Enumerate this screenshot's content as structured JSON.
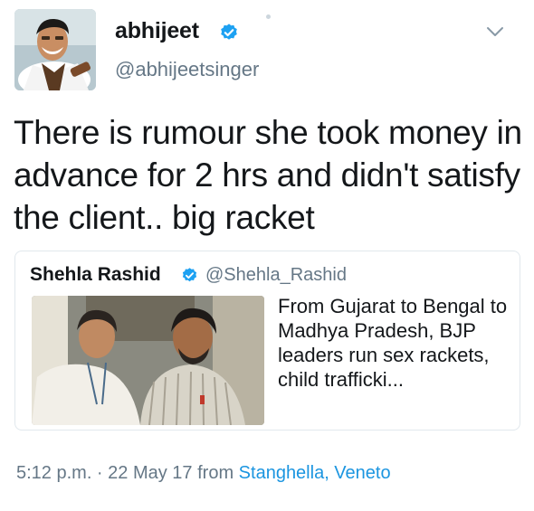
{
  "author": {
    "display_name": "abhijeet",
    "handle": "@abhijeetsinger",
    "verified": true
  },
  "tweet_text": "There is rumour she took money in advance for 2 hrs and didn't satisfy the client.. big racket",
  "quoted_tweet": {
    "display_name": "Shehla Rashid",
    "handle": "@Shehla_Rashid",
    "verified": true,
    "text": "From Gujarat to Bengal to Madhya Pradesh, BJP leaders run sex rackets, child trafficki..."
  },
  "meta": {
    "timestamp": "5:12 p.m. · 22 May 17",
    "from_label": "from",
    "place": "Stanghella, Veneto"
  },
  "icons": {
    "verified": "verified-badge-icon",
    "menu": "chevron-down-icon"
  },
  "colors": {
    "verified_blue": "#1da1f2",
    "link_blue": "#1b95e0",
    "secondary_text": "#657786",
    "border": "#e1e8ed"
  }
}
